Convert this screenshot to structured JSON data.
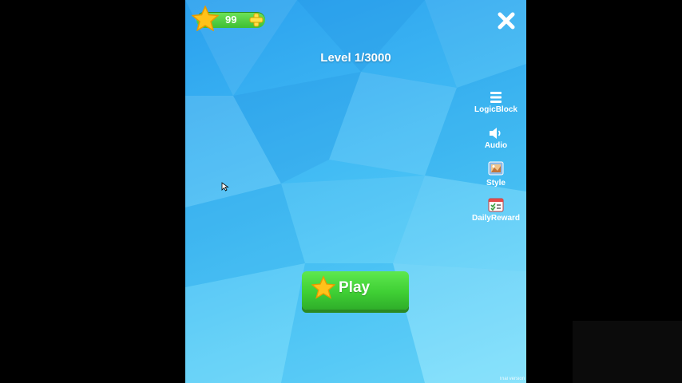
{
  "coins": {
    "value": "99"
  },
  "level": {
    "label": "Level  1/3000"
  },
  "side_menu": [
    {
      "id": "logicblock",
      "label": "LogicBlock",
      "icon": "menu-icon"
    },
    {
      "id": "audio",
      "label": "Audio",
      "icon": "speaker-icon"
    },
    {
      "id": "style",
      "label": "Style",
      "icon": "palette-icon"
    },
    {
      "id": "dailyreward",
      "label": "DailyReward",
      "icon": "calendar-icon"
    }
  ],
  "play_button": {
    "label": "Play"
  },
  "footer": {
    "version": "Trial version"
  },
  "colors": {
    "accent_green": "#3fcf34",
    "star_yellow": "#ffc21a",
    "bg_blue": "#3db6f3"
  }
}
